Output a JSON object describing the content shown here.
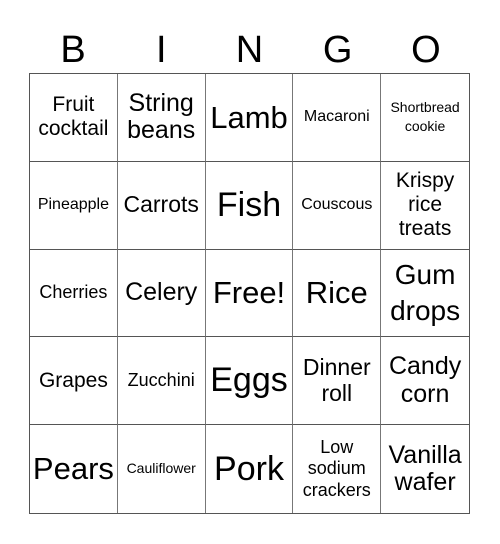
{
  "header": [
    "B",
    "I",
    "N",
    "G",
    "O"
  ],
  "cells": [
    "Fruit cocktail",
    "String beans",
    "Lamb",
    "Macaroni",
    "Shortbread cookie",
    "Pineapple",
    "Carrots",
    "Fish",
    "Couscous",
    "Krispy rice treats",
    "Cherries",
    "Celery",
    "Free!",
    "Rice",
    "Gum drops",
    "Grapes",
    "Zucchini",
    "Eggs",
    "Dinner roll",
    "Candy corn",
    "Pears",
    "Cauliflower",
    "Pork",
    "Low sodium crackers",
    "Vanilla wafer"
  ]
}
